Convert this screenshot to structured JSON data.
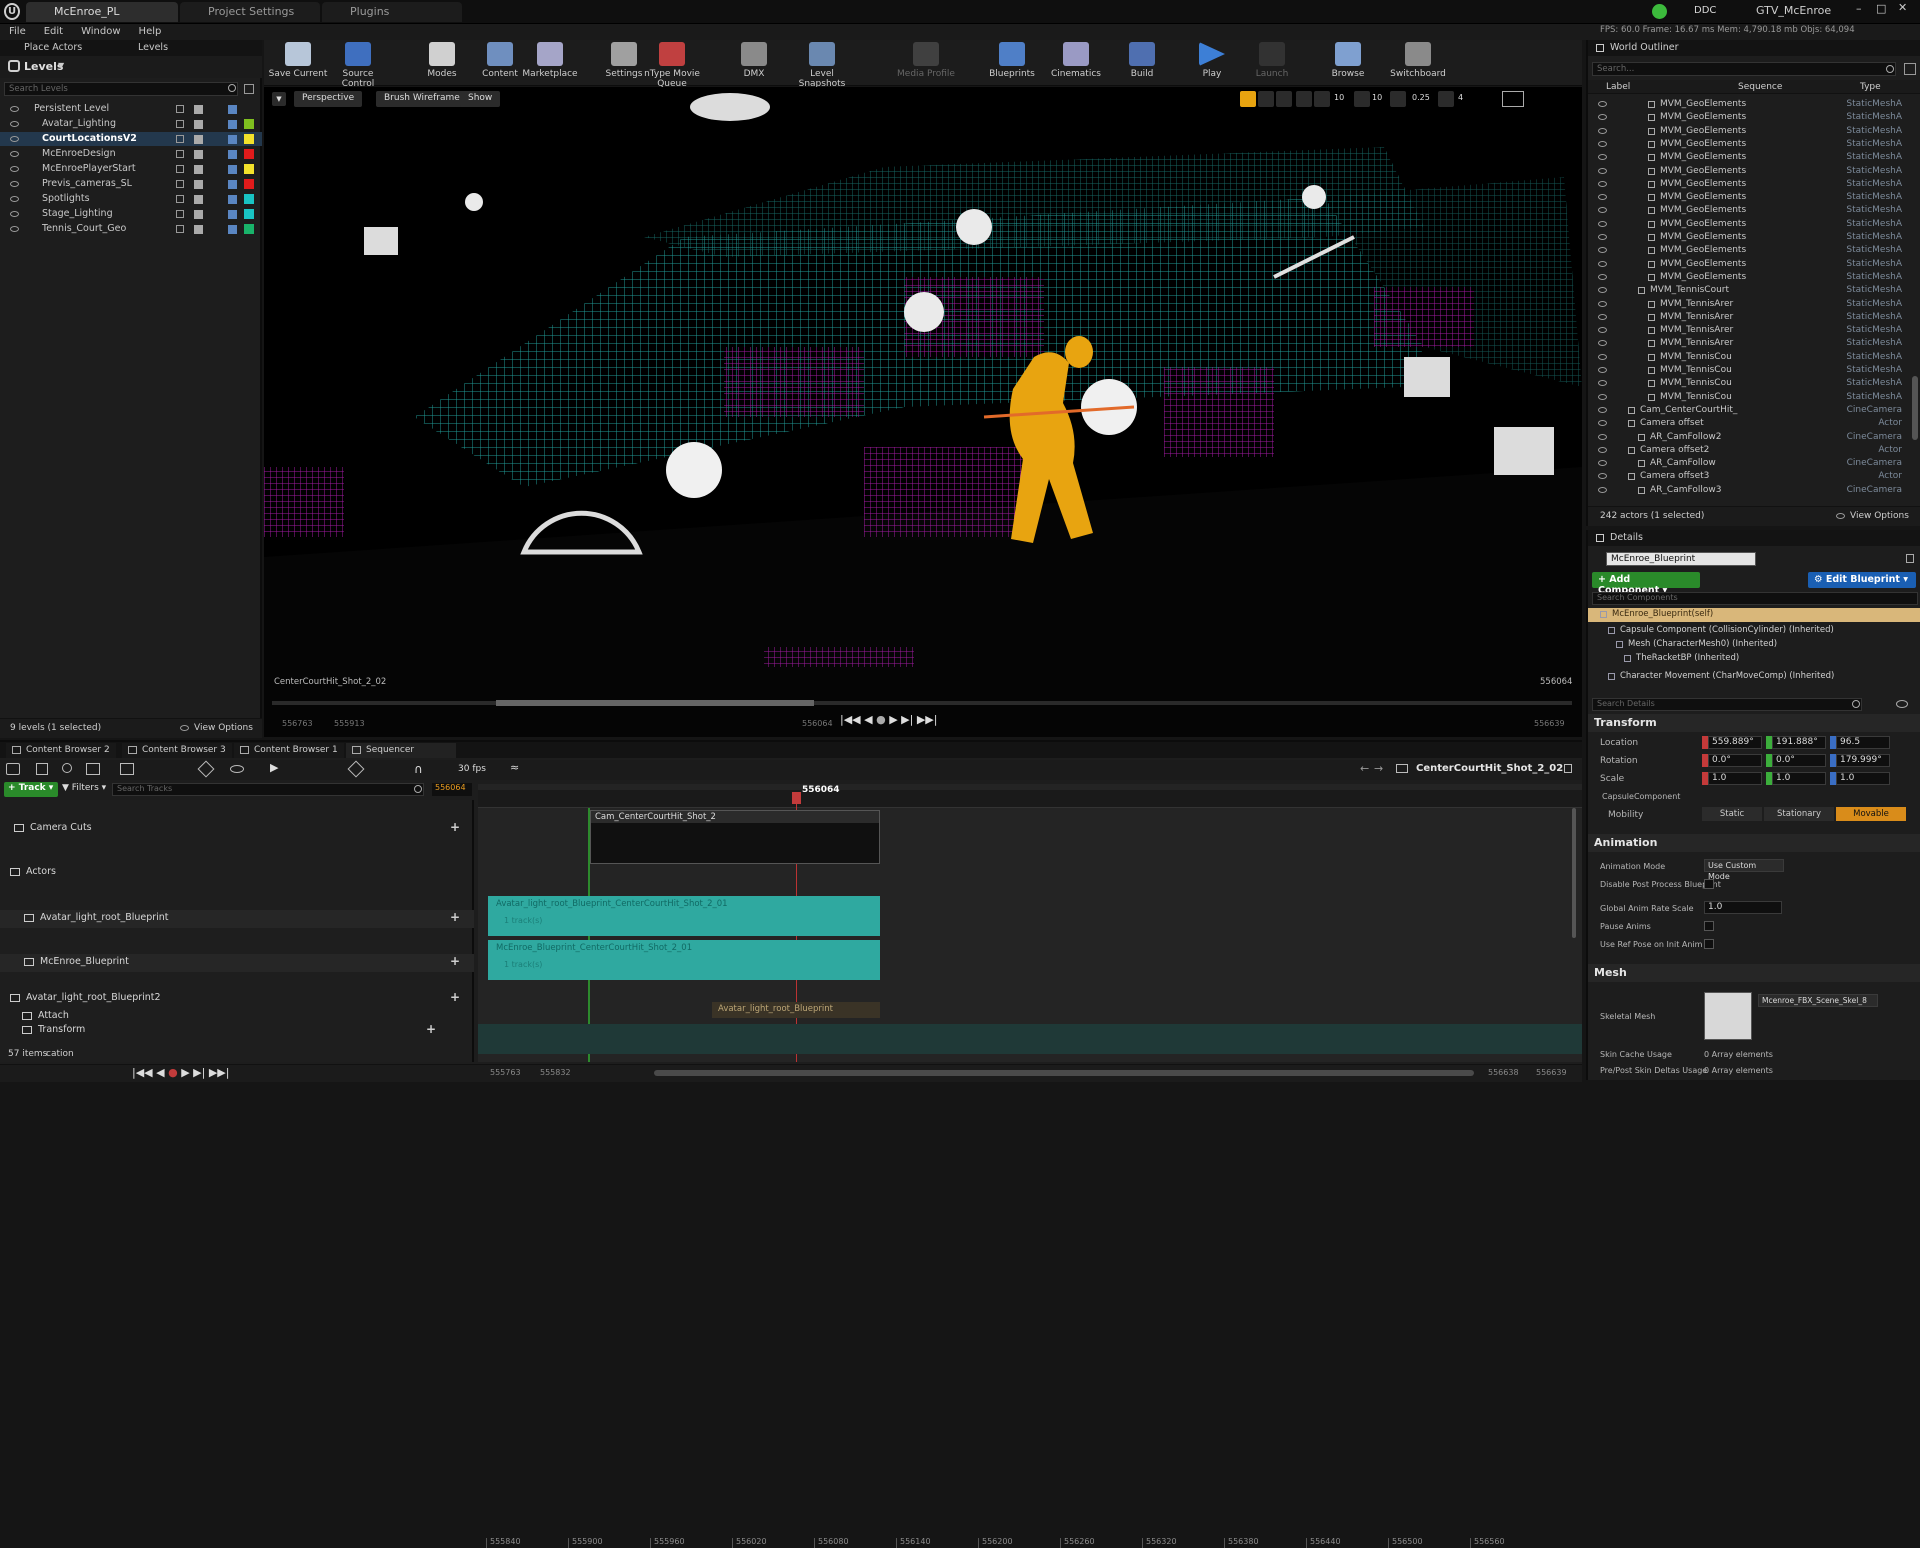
{
  "tabs": [
    {
      "label": "McEnroe_PL"
    },
    {
      "label": "Project Settings"
    },
    {
      "label": "Plugins"
    }
  ],
  "title_right": {
    "source": "DDC",
    "project": "GTV_McEnroe",
    "stats": "FPS: 60.0   Frame: 16.67 ms   Mem: 4,790.18 mb   Objs: 64,094"
  },
  "menu": [
    "File",
    "Edit",
    "Window",
    "Help"
  ],
  "left_tabs": {
    "place_actors": "Place Actors",
    "levels": "Levels"
  },
  "levels": {
    "title": "Levels",
    "search_placeholder": "Search Levels",
    "items": [
      {
        "label": "Persistent Level",
        "color": ""
      },
      {
        "label": "Avatar_Lighting",
        "color": "#7fbf1f"
      },
      {
        "label": "CourtLocationsV2",
        "color": "#f3e12b"
      },
      {
        "label": "McEnroeDesign",
        "color": "#e01b1b"
      },
      {
        "label": "McEnroePlayerStart",
        "color": "#f3e12b"
      },
      {
        "label": "Previs_cameras_SL",
        "color": "#e01b1b"
      },
      {
        "label": "Spotlights",
        "color": "#19c3c3"
      },
      {
        "label": "Stage_Lighting",
        "color": "#19c3c3"
      },
      {
        "label": "Tennis_Court_Geo",
        "color": "#19b36a"
      }
    ],
    "footer": "9 levels (1 selected)",
    "view_options": "View Options"
  },
  "toolbar": [
    {
      "label": "Save Current",
      "icon": "save-icon"
    },
    {
      "label": "Source Control",
      "icon": "source-control-icon"
    },
    {
      "label": "Modes",
      "icon": "modes-icon"
    },
    {
      "label": "Content",
      "icon": "content-icon"
    },
    {
      "label": "Marketplace",
      "icon": "marketplace-icon"
    },
    {
      "label": "Settings",
      "icon": "settings-icon"
    },
    {
      "label": "nType Movie Queue",
      "icon": "movie-queue-icon"
    },
    {
      "label": "DMX",
      "icon": "dmx-icon"
    },
    {
      "label": "Level Snapshots",
      "icon": "snapshot-icon"
    },
    {
      "label": "Media Profile",
      "icon": "media-profile-icon"
    },
    {
      "label": "Blueprints",
      "icon": "blueprint-icon"
    },
    {
      "label": "Cinematics",
      "icon": "cinematics-icon"
    },
    {
      "label": "Build",
      "icon": "build-icon"
    },
    {
      "label": "Play",
      "icon": "play-icon"
    },
    {
      "label": "Launch",
      "icon": "launch-icon"
    },
    {
      "label": "Browse",
      "icon": "browse-icon"
    },
    {
      "label": "Switchboard",
      "icon": "switchboard-icon"
    }
  ],
  "viewport": {
    "perspective": "Perspective",
    "wireframe": "Brush Wireframe",
    "show": "Show",
    "shot_label": "CenterCourtHit_Shot_2_02",
    "frame_right": "556064",
    "range_start": "556763",
    "range_in": "555913",
    "frame_current": "556064",
    "frame_end": "556639",
    "grid_snap": "10",
    "rot_snap": "10",
    "scale_snap": "0.25",
    "cam_speed": "4"
  },
  "outliner": {
    "title": "World Outliner",
    "search_placeholder": "Search...",
    "col_label": "Label",
    "col_sequence": "Sequence",
    "col_type": "Type",
    "rows": [
      {
        "label": "MVM_GeoElements",
        "type": "StaticMeshA",
        "indent": 3
      },
      {
        "label": "MVM_GeoElements",
        "type": "StaticMeshA",
        "indent": 3
      },
      {
        "label": "MVM_GeoElements",
        "type": "StaticMeshA",
        "indent": 3
      },
      {
        "label": "MVM_GeoElements",
        "type": "StaticMeshA",
        "indent": 3
      },
      {
        "label": "MVM_GeoElements",
        "type": "StaticMeshA",
        "indent": 3
      },
      {
        "label": "MVM_GeoElements",
        "type": "StaticMeshA",
        "indent": 3
      },
      {
        "label": "MVM_GeoElements",
        "type": "StaticMeshA",
        "indent": 3
      },
      {
        "label": "MVM_GeoElements",
        "type": "StaticMeshA",
        "indent": 3
      },
      {
        "label": "MVM_GeoElements",
        "type": "StaticMeshA",
        "indent": 3
      },
      {
        "label": "MVM_GeoElements",
        "type": "StaticMeshA",
        "indent": 3
      },
      {
        "label": "MVM_GeoElements",
        "type": "StaticMeshA",
        "indent": 3
      },
      {
        "label": "MVM_GeoElements",
        "type": "StaticMeshA",
        "indent": 3
      },
      {
        "label": "MVM_GeoElements",
        "type": "StaticMeshA",
        "indent": 3
      },
      {
        "label": "MVM_GeoElements",
        "type": "StaticMeshA",
        "indent": 3
      },
      {
        "label": "MVM_TennisCourt",
        "type": "StaticMeshA",
        "indent": 2
      },
      {
        "label": "MVM_TennisArer",
        "type": "StaticMeshA",
        "indent": 3
      },
      {
        "label": "MVM_TennisArer",
        "type": "StaticMeshA",
        "indent": 3
      },
      {
        "label": "MVM_TennisArer",
        "type": "StaticMeshA",
        "indent": 3
      },
      {
        "label": "MVM_TennisArer",
        "type": "StaticMeshA",
        "indent": 3
      },
      {
        "label": "MVM_TennisCou",
        "type": "StaticMeshA",
        "indent": 3
      },
      {
        "label": "MVM_TennisCou",
        "type": "StaticMeshA",
        "indent": 3
      },
      {
        "label": "MVM_TennisCou",
        "type": "StaticMeshA",
        "indent": 3
      },
      {
        "label": "MVM_TennisCou",
        "type": "StaticMeshA",
        "indent": 3
      },
      {
        "label": "Cam_CenterCourtHit_",
        "type": "CineCamera",
        "indent": 1
      },
      {
        "label": "Camera offset",
        "type": "Actor",
        "indent": 1
      },
      {
        "label": "AR_CamFollow2",
        "type": "CineCamera",
        "indent": 2
      },
      {
        "label": "Camera offset2",
        "type": "Actor",
        "indent": 1
      },
      {
        "label": "AR_CamFollow",
        "type": "CineCamera",
        "indent": 2
      },
      {
        "label": "Camera offset3",
        "type": "Actor",
        "indent": 1
      },
      {
        "label": "AR_CamFollow3",
        "type": "CineCamera",
        "indent": 2
      }
    ],
    "footer": "242 actors (1 selected)",
    "view_options": "View Options"
  },
  "details": {
    "title": "Details",
    "name_value": "McEnroe_Blueprint",
    "add_component": "+ Add Component",
    "edit_blueprint": "Edit Blueprint",
    "search_components": "Search Components",
    "components": [
      {
        "label": "McEnroe_Blueprint(self)",
        "indent": 0
      },
      {
        "label": "Capsule Component (CollisionCylinder) (Inherited)",
        "indent": 1
      },
      {
        "label": "Mesh (CharacterMesh0) (Inherited)",
        "indent": 2
      },
      {
        "label": "TheRacketBP (Inherited)",
        "indent": 3
      },
      {
        "label": "Character Movement (CharMoveComp) (Inherited)",
        "indent": 1
      }
    ],
    "search_details": "Search Details",
    "transform": {
      "title": "Transform",
      "location_label": "Location",
      "rotation_label": "Rotation",
      "scale_label": "Scale",
      "location": [
        "559.889°",
        "191.888°",
        "96.5"
      ],
      "rotation": [
        "0.0°",
        "0.0°",
        "179.999°"
      ],
      "scale": [
        "1.0",
        "1.0",
        "1.0"
      ],
      "capsule": "CapsuleComponent",
      "mobility_label": "Mobility",
      "mobility": [
        "Static",
        "Stationary",
        "Movable"
      ]
    },
    "animation": {
      "title": "Animation",
      "mode_label": "Animation Mode",
      "mode_value": "Use Custom Mode",
      "disable_pp": "Disable Post Process Blueprint",
      "global_rate": "Global Anim Rate Scale",
      "global_rate_value": "1.0",
      "pause": "Pause Anims",
      "ref_pose": "Use Ref Pose on Init Anim"
    },
    "mesh": {
      "title": "Mesh",
      "skeletal_label": "Skeletal Mesh",
      "skeletal_value": "Mcenroe_FBX_Scene_Skel_8",
      "skin_cache": "Skin Cache Usage",
      "skin_cache_value": "0 Array elements",
      "pre_post": "Pre/Post Skin Deltas Usage",
      "pre_post_value": "0 Array elements"
    }
  },
  "bottom_tabs": [
    "Content Browser 2",
    "Content Browser 3",
    "Content Browser 1",
    "Sequencer"
  ],
  "sequencer": {
    "fps": "30 fps",
    "track": "Track",
    "filters": "Filters",
    "search_placeholder": "Search Tracks",
    "frame_field": "556064",
    "shot_name": "CenterCourtHit_Shot_2_02",
    "current_frame": "556064",
    "ticks": [
      "555840",
      "555900",
      "555960",
      "556020",
      "556080",
      "556140",
      "556200",
      "556260",
      "556320",
      "556380",
      "556440",
      "556500",
      "556560"
    ],
    "tracks": [
      {
        "label": "Camera Cuts",
        "kind": "top"
      },
      {
        "label": "Actors",
        "kind": "folder"
      },
      {
        "label": "Avatar_light_root_Blueprint",
        "kind": "actor"
      },
      {
        "label": "McEnroe_Blueprint",
        "kind": "actor"
      },
      {
        "label": "Avatar_light_root_Blueprint2",
        "kind": "actor2"
      },
      {
        "label": "Attach",
        "kind": "sub"
      },
      {
        "label": "Transform",
        "kind": "sub"
      }
    ],
    "clip_camera": "Cam_CenterCourtHit_Shot_2",
    "clip_avatar": "Avatar_light_root_Blueprint_CenterCourtHit_Shot_2_01",
    "clip_avatar_sub": "1 track(s)",
    "clip_mcenroe": "McEnroe_Blueprint_CenterCourtHit_Shot_2_01",
    "clip_mcenroe_sub": "1 track(s)",
    "clip_attach": "Avatar_light_root_Blueprint",
    "footer": "57 items",
    "footer_word": "cation",
    "range_a": "555763",
    "range_b": "555832",
    "range_c": "556638",
    "range_d": "556639"
  }
}
